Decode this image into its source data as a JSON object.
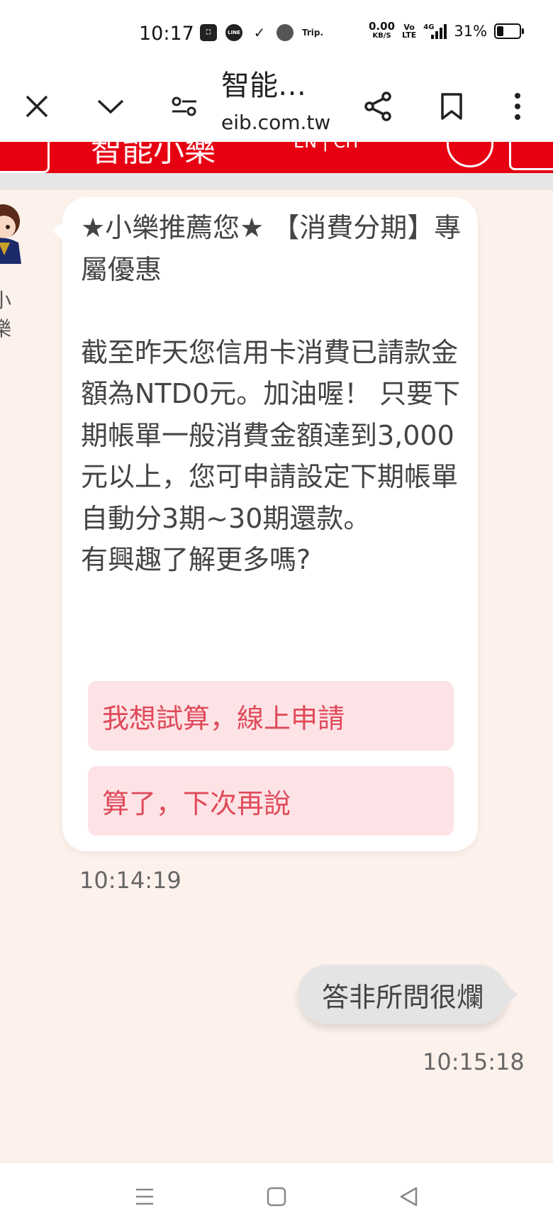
{
  "status_bar": {
    "time": "10:17",
    "app_icons": [
      "shopee-icon",
      "line-icon",
      "nike-icon",
      "stack-icon",
      "trip-icon"
    ],
    "trip_label": "Trip.",
    "line_label": "LINE",
    "net_speed_value": "0.00",
    "net_speed_unit": "KB/S",
    "volte_top": "Vo",
    "volte_bottom": "LTE",
    "signal_type": "4G",
    "battery_percent": "31%",
    "battery_level": 0.31
  },
  "browser": {
    "page_title": "智能…",
    "domain": "eib.com.tw"
  },
  "app_header": {
    "title": "智能小樂",
    "lang": "EN | CH",
    "accent": "#e60012"
  },
  "chat": {
    "bot_name": "小樂",
    "bot_message": "★小樂推薦您★ 【消費分期】專屬優惠\n\n截至昨天您信用卡消費已請款金額為NTD0元。加油喔！ 只要下期帳單一般消費金額達到3,000元以上，您可申請設定下期帳單自動分3期~30期還款。\n有興趣了解更多嗎?",
    "options": [
      "我想試算，線上申請",
      "算了，下次再說"
    ],
    "bot_time": "10:14:19",
    "user_message": "答非所問很爛",
    "user_time": "10:15:18"
  },
  "colors": {
    "chat_background": "#fdf1ec",
    "option_background": "#fde3e5",
    "option_text": "#e04a5a"
  }
}
